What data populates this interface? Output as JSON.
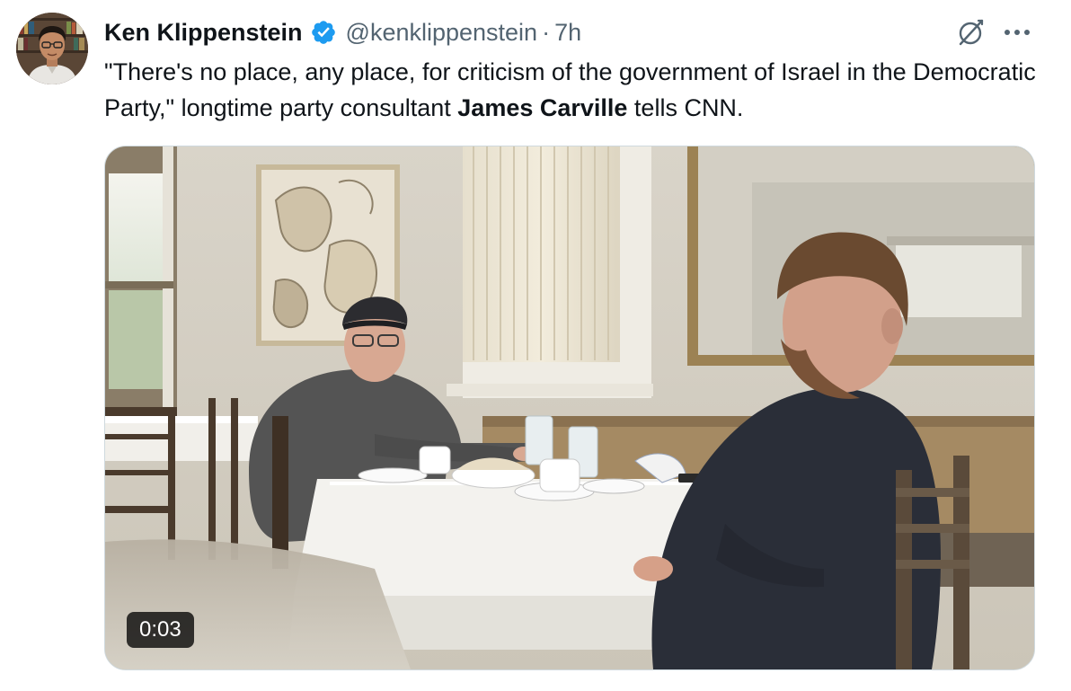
{
  "tweet": {
    "author": {
      "display_name": "Ken Klippenstein",
      "handle": "@kenklippenstein",
      "verified": true,
      "avatar_icon": "avatar-photo"
    },
    "separator": "·",
    "time": "7h",
    "text_parts": {
      "intro": "\"There's no place, any place, for criticism of the government of Israel in the Democratic Party,\" longtime party consultant ",
      "bold_name": "James Carville",
      "outro": " tells CNN."
    },
    "media": {
      "type": "video",
      "duration": "0:03"
    },
    "icons": {
      "verified": "verified-badge-icon",
      "grok": "grok-icon",
      "more": "more-icon"
    },
    "colors": {
      "verified_blue": "#1d9bf0",
      "secondary_text": "#536471",
      "primary_text": "#0f1419",
      "media_border": "#cfd9de"
    }
  }
}
